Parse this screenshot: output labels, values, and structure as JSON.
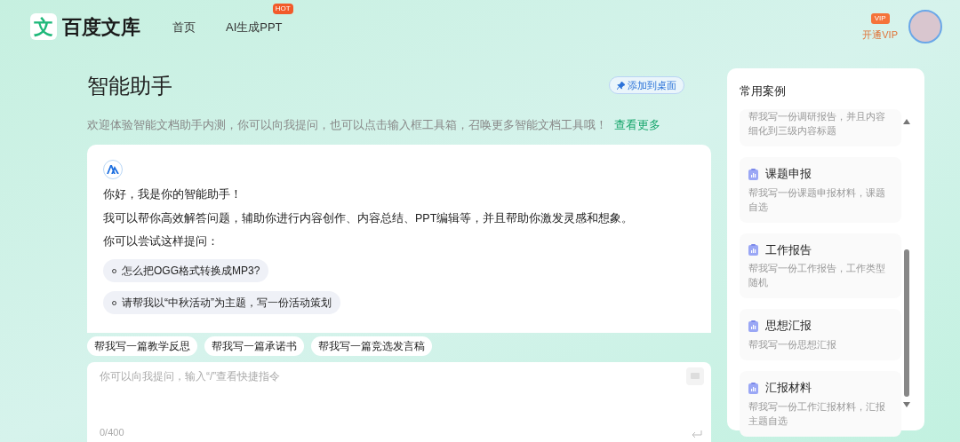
{
  "header": {
    "logo_glyph": "文",
    "logo_text": "百度文库",
    "nav": [
      {
        "label": "首页"
      },
      {
        "label": "AI生成PPT",
        "badge": "HOT"
      }
    ],
    "vip": {
      "badge": "VIP",
      "label": "开通VIP"
    }
  },
  "page": {
    "title": "智能助手",
    "pin_button": "添加到桌面",
    "intro": "欢迎体验智能文档助手内测，你可以向我提问，也可以点击输入框工具箱，召唤更多智能文档工具哦！",
    "intro_link": "查看更多"
  },
  "chat": {
    "lines": [
      "你好，我是你的智能助手！",
      "我可以帮你高效解答问题，辅助你进行内容创作、内容总结、PPT编辑等，并且帮助你激发灵感和想象。",
      "你可以尝试这样提问："
    ],
    "suggestions": [
      "怎么把OGG格式转换成MP3?",
      "请帮我以“中秋活动”为主题，写一份活动策划"
    ]
  },
  "quick_prompts": [
    "帮我写一篇教学反思",
    "帮我写一篇承诺书",
    "帮我写一篇竞选发言稿"
  ],
  "input": {
    "placeholder": "你可以向我提问，输入“/”查看快捷指令",
    "counter": "0/400"
  },
  "cases": {
    "title": "常用案例",
    "items": [
      {
        "desc": "帮我写一份调研报告，并且内容细化到三级内容标题"
      },
      {
        "title": "课题申报",
        "desc": "帮我写一份课题申报材料，课题自选"
      },
      {
        "title": "工作报告",
        "desc": "帮我写一份工作报告，工作类型随机"
      },
      {
        "title": "思想汇报",
        "desc": "帮我写一份思想汇报"
      },
      {
        "title": "汇报材料",
        "desc": "帮我写一份工作汇报材料，汇报主题自选"
      }
    ]
  }
}
